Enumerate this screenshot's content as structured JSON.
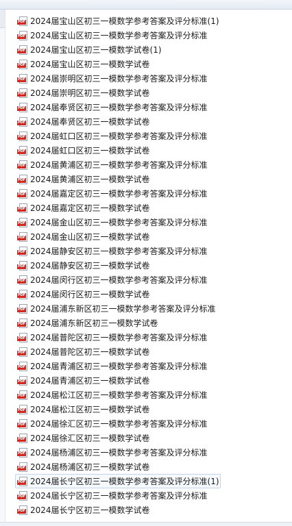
{
  "file_list": {
    "icon": "pdf-file-icon",
    "icon_badge": "PDF",
    "selected_index": 32,
    "items": [
      "2024届宝山区初三一模数学参考答案及评分标准(1)",
      "2024届宝山区初三一模数学参考答案及评分标准",
      "2024届宝山区初三一模数学试卷(1)",
      "2024届宝山区初三一模数学试卷",
      "2024届崇明区初三一模数学参考答案及评分标准",
      "2024届崇明区初三一模数学试卷",
      "2024届奉贤区初三一模数学参考答案及评分标准",
      "2024届奉贤区初三一模数学试卷",
      "2024届虹口区初三一模数学参考答案及评分标准",
      "2024届虹口区初三一模数学试卷",
      "2024届黄浦区初三一模数学参考答案及评分标准",
      "2024届黄浦区初三一模数学试卷",
      "2024届嘉定区初三一模数学参考答案及评分标准",
      "2024届嘉定区初三一模数学试卷",
      "2024届金山区初三一模数学参考答案及评分标准",
      "2024届金山区初三一模数学试卷",
      "2024届静安区初三一模数学参考答案及评分标准",
      "2024届静安区初三一模数学试卷",
      "2024届闵行区初三一模数学参考答案及评分标准",
      "2024届闵行区初三一模数学试卷",
      "2024届浦东新区初三一模数学参考答案及评分标准",
      "2024届浦东新区初三一模数学试卷",
      "2024届普陀区初三一模数学参考答案及评分标准",
      "2024届普陀区初三一模数学试卷",
      "2024届青浦区初三一模数学参考答案及评分标准",
      "2024届青浦区初三一模数学试卷",
      "2024届松江区初三一模数学参考答案及评分标准",
      "2024届松江区初三一模数学试卷",
      "2024届徐汇区初三一模数学参考答案及评分标准",
      "2024届徐汇区初三一模数学试卷",
      "2024届杨浦区初三一模数学参考答案及评分标准",
      "2024届杨浦区初三一模数学试卷",
      "2024届长宁区初三一模数学参考答案及评分标准(1)",
      "2024届长宁区初三一模数学参考答案及评分标准",
      "2024届长宁区初三一模数学试卷"
    ]
  }
}
